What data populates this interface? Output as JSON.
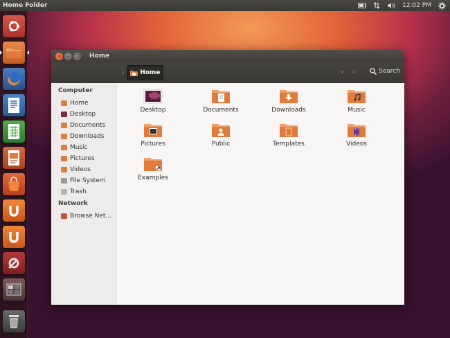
{
  "top_panel": {
    "title": "Home Folder",
    "time": "12:02 PM"
  },
  "launcher": {
    "items": [
      {
        "name": "dash",
        "color": "#c8463a"
      },
      {
        "name": "home-folder",
        "color": "#d57a3a"
      },
      {
        "name": "firefox",
        "color": "#3a6fb5"
      },
      {
        "name": "writer",
        "color": "#3b6cb0"
      },
      {
        "name": "calc",
        "color": "#3b9a3b"
      },
      {
        "name": "impress",
        "color": "#c7562b"
      },
      {
        "name": "software-center",
        "color": "#d0552a"
      },
      {
        "name": "ubuntu-one",
        "color": "#e06a1f"
      },
      {
        "name": "ubuntu-one-music",
        "color": "#e06a1f"
      },
      {
        "name": "system-settings",
        "color": "#9b2d2d"
      },
      {
        "name": "workspace-switcher",
        "color": "#6b4a4a"
      },
      {
        "name": "trash",
        "color": "#5a5a5a"
      }
    ]
  },
  "window": {
    "title": "Home",
    "breadcrumb": "Home",
    "search_label": "Search",
    "sidebar": {
      "computer_header": "Computer",
      "items": [
        "Home",
        "Desktop",
        "Documents",
        "Downloads",
        "Music",
        "Pictures",
        "Videos",
        "File System",
        "Trash"
      ],
      "network_header": "Network",
      "network_items": [
        "Browse Net..."
      ]
    },
    "files": [
      "Desktop",
      "Documents",
      "Downloads",
      "Music",
      "Pictures",
      "Public",
      "Templates",
      "Videos",
      "Examples"
    ]
  },
  "colors": {
    "accent": "#d2692d",
    "folder": "#e07b3c"
  }
}
